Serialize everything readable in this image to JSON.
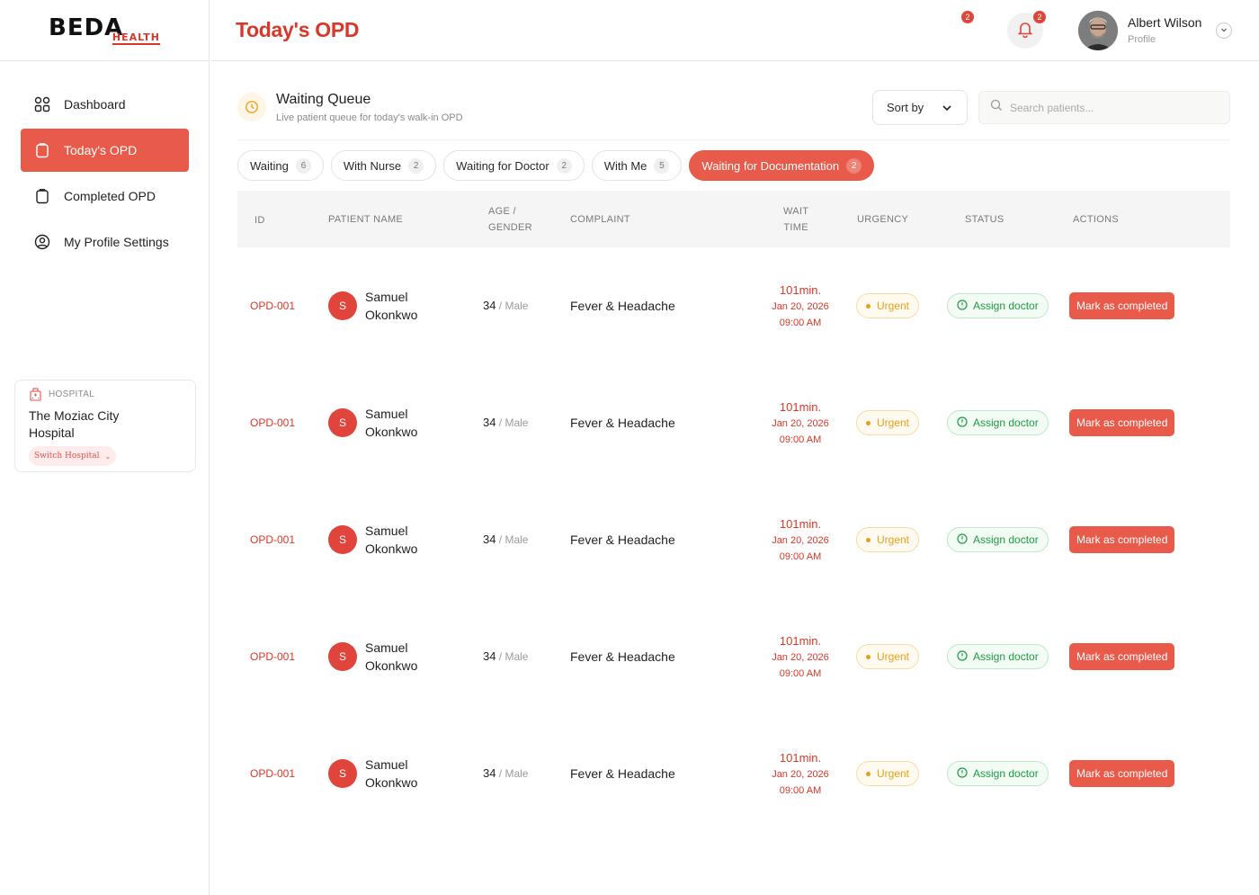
{
  "brand": {
    "logo_text": "BEDA",
    "logo_sub": "HEALTH"
  },
  "sidebar": {
    "items": [
      {
        "label": "Dashboard",
        "icon": "grid-icon"
      },
      {
        "label": "Today's OPD",
        "icon": "clipboard-icon",
        "active": true
      },
      {
        "label": "Completed OPD",
        "icon": "clipboard-check-icon"
      },
      {
        "label": "My Profile Settings",
        "icon": "user-circle-icon"
      }
    ],
    "hospital": {
      "label": "HOSPITAL",
      "name": "The Moziac City Hospital",
      "switch_label": "Switch Hospital"
    }
  },
  "header": {
    "title": "Today's OPD",
    "notif_count_1": "2",
    "notif_count_2": "2",
    "user_name": "Albert Wilson",
    "user_role": "Profile"
  },
  "queue": {
    "title": "Waiting Queue",
    "subtitle": "Live patient queue for today's walk-in OPD",
    "sort_label": "Sort by",
    "search_placeholder": "Search patients..."
  },
  "tabs": [
    {
      "label": "Waiting",
      "count": "6"
    },
    {
      "label": "With Nurse",
      "count": "2"
    },
    {
      "label": "Waiting for Doctor",
      "count": "2"
    },
    {
      "label": "With Me",
      "count": "5"
    },
    {
      "label": "Waiting for Documentation",
      "count": "2",
      "active": true
    }
  ],
  "table": {
    "headers": {
      "id": "ID",
      "patient_name": "PATIENT NAME",
      "age_1": "AGE /",
      "age_2": "GENDER",
      "complaint": "COMPLAINT",
      "wait_1": "WAIT",
      "wait_2": "TIME",
      "urgency": "URGENCY",
      "status": "STATUS",
      "actions": "ACTIONS"
    },
    "rows": [
      {
        "id": "OPD-001",
        "initial": "S",
        "first": "Samuel",
        "last": "Okonkwo",
        "age": "34",
        "gender": " / Male",
        "complaint": "Fever & Headache",
        "wait": "101min.",
        "date": "Jan 20, 2026",
        "time": "09:00 AM",
        "urgency": "Urgent",
        "status": "Assign doctor",
        "action": "Mark as completed"
      },
      {
        "id": "OPD-001",
        "initial": "S",
        "first": "Samuel",
        "last": "Okonkwo",
        "age": "34",
        "gender": " / Male",
        "complaint": "Fever & Headache",
        "wait": "101min.",
        "date": "Jan 20, 2026",
        "time": "09:00 AM",
        "urgency": "Urgent",
        "status": "Assign doctor",
        "action": "Mark as completed"
      },
      {
        "id": "OPD-001",
        "initial": "S",
        "first": "Samuel",
        "last": "Okonkwo",
        "age": "34",
        "gender": " / Male",
        "complaint": "Fever & Headache",
        "wait": "101min.",
        "date": "Jan 20, 2026",
        "time": "09:00 AM",
        "urgency": "Urgent",
        "status": "Assign doctor",
        "action": "Mark as completed"
      },
      {
        "id": "OPD-001",
        "initial": "S",
        "first": "Samuel",
        "last": "Okonkwo",
        "age": "34",
        "gender": " / Male",
        "complaint": "Fever & Headache",
        "wait": "101min.",
        "date": "Jan 20, 2026",
        "time": "09:00 AM",
        "urgency": "Urgent",
        "status": "Assign doctor",
        "action": "Mark as completed"
      },
      {
        "id": "OPD-001",
        "initial": "S",
        "first": "Samuel",
        "last": "Okonkwo",
        "age": "34",
        "gender": " / Male",
        "complaint": "Fever & Headache",
        "wait": "101min.",
        "date": "Jan 20, 2026",
        "time": "09:00 AM",
        "urgency": "Urgent",
        "status": "Assign doctor",
        "action": "Mark as completed"
      }
    ]
  },
  "colors": {
    "accent": "#e85a4a",
    "brand_red": "#d9372a",
    "urgent": "#e3a11a",
    "success": "#1e9a43"
  }
}
